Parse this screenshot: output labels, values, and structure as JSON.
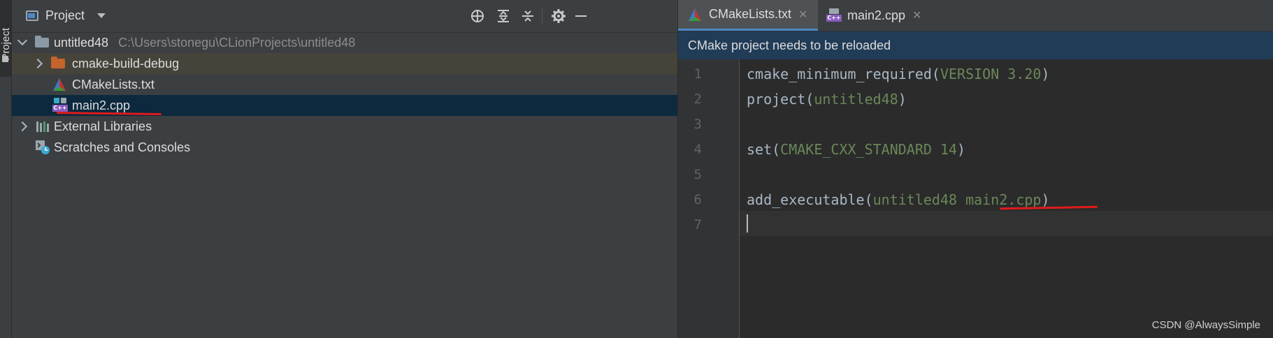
{
  "side_strip": {
    "project_tab_label": "Project"
  },
  "project_panel": {
    "title": "Project",
    "tree": [
      {
        "label": "untitled48",
        "path": "C:\\Users\\stonegu\\CLionProjects\\untitled48"
      },
      {
        "label": "cmake-build-debug"
      },
      {
        "label": "CMakeLists.txt"
      },
      {
        "label": "main2.cpp"
      },
      {
        "label": "External Libraries"
      },
      {
        "label": "Scratches and Consoles"
      }
    ],
    "icons": [
      "locate-icon",
      "expand-all-icon",
      "collapse-all-icon",
      "gear-icon",
      "hide-icon"
    ]
  },
  "editor": {
    "tabs": [
      {
        "label": "CMakeLists.txt",
        "active": true
      },
      {
        "label": "main2.cpp",
        "active": false
      }
    ],
    "notification": "CMake project needs to be reloaded",
    "line_numbers": [
      "1",
      "2",
      "3",
      "4",
      "5",
      "6",
      "7"
    ],
    "lines": [
      {
        "cmd": "cmake_minimum_required",
        "args": "VERSION 3.20"
      },
      {
        "cmd": "project",
        "args": "untitled48"
      },
      {
        "cmd": "",
        "args": ""
      },
      {
        "cmd": "set",
        "args": "CMAKE_CXX_STANDARD 14"
      },
      {
        "cmd": "",
        "args": ""
      },
      {
        "cmd": "add_executable",
        "args_a": "untitled48 ",
        "args_b": "main2.cpp"
      },
      {
        "cmd": "",
        "args": ""
      }
    ],
    "paren_open": "(",
    "paren_close": ")"
  },
  "watermark": "CSDN @AlwaysSimple",
  "colors": {
    "selection": "#0d293e",
    "notification_bg": "#213c57",
    "cmake_arg": "#6a8759",
    "annotation_red": "#e01b1b"
  }
}
